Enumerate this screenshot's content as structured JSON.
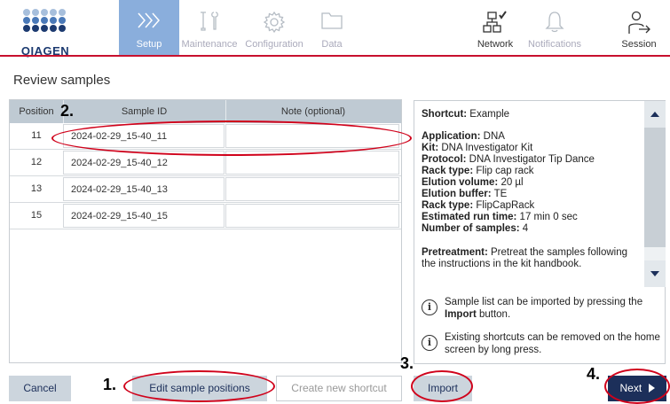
{
  "brand": {
    "logo_text": "QIAGEN"
  },
  "nav": {
    "setup": "Setup",
    "maintenance": "Maintenance",
    "configuration": "Configuration",
    "data": "Data",
    "network": "Network",
    "notifications": "Notifications",
    "session": "Session"
  },
  "page": {
    "title": "Review samples"
  },
  "table": {
    "headers": {
      "position": "Position",
      "sample_id": "Sample ID",
      "note": "Note (optional)"
    },
    "rows": [
      {
        "position": "11",
        "sample_id": "2024-02-29_15-40_11",
        "note": ""
      },
      {
        "position": "12",
        "sample_id": "2024-02-29_15-40_12",
        "note": ""
      },
      {
        "position": "13",
        "sample_id": "2024-02-29_15-40_13",
        "note": ""
      },
      {
        "position": "15",
        "sample_id": "2024-02-29_15-40_15",
        "note": ""
      }
    ]
  },
  "info": {
    "shortcut_label": "Shortcut:",
    "shortcut_value": " Example",
    "application_label": "Application:",
    "application_value": " DNA",
    "kit_label": "Kit:",
    "kit_value": " DNA Investigator Kit",
    "protocol_label": "Protocol:",
    "protocol_value": " DNA Investigator Tip Dance",
    "rack_type_label": "Rack type:",
    "rack_type_value": " Flip cap rack",
    "elution_volume_label": "Elution volume:",
    "elution_volume_value": " 20 µl",
    "elution_buffer_label": "Elution buffer:",
    "elution_buffer_value": " TE",
    "rack_type2_label": "Rack type:",
    "rack_type2_value": " FlipCapRack",
    "run_time_label": "Estimated run time:",
    "run_time_value": " 17 min 0 sec",
    "num_samples_label": "Number of samples:",
    "num_samples_value": " 4",
    "pretreatment_label": "Pretreatment:",
    "pretreatment_value": " Pretreat the samples following the instructions in the kit handbook.",
    "tip1_pre": "Sample list can be imported by pressing the ",
    "tip1_bold": "Import",
    "tip1_post": " button.",
    "tip2": "Existing shortcuts can be removed on the home screen by long press."
  },
  "buttons": {
    "cancel": "Cancel",
    "edit_positions": "Edit sample positions",
    "create_shortcut": "Create new shortcut",
    "import": "Import",
    "next": "Next"
  },
  "annotations": {
    "n1": "1.",
    "n2": "2.",
    "n3": "3.",
    "n4": "4."
  },
  "colors": {
    "accent_red": "#c8102e",
    "nav_active": "#8aaedc",
    "primary": "#1c2f5a",
    "annotation": "#d0021b"
  }
}
